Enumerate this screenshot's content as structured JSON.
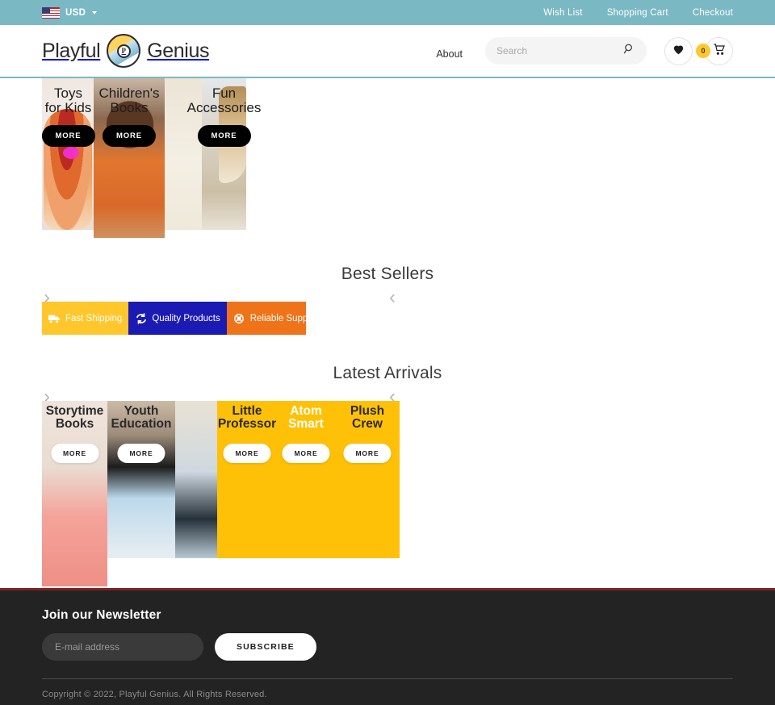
{
  "topbar": {
    "currency": "USD",
    "flag_icon": "us-flag-icon",
    "links": [
      {
        "label": "Wish List"
      },
      {
        "label": "Shopping Cart"
      },
      {
        "label": "Checkout"
      }
    ]
  },
  "header": {
    "logo_left": "Playful",
    "logo_mark_letter": "P",
    "logo_right": "Genius",
    "nav_about": "About",
    "search_placeholder": "Search",
    "search_value": "",
    "search_icon": "search-icon",
    "wishlist_icon": "heart-icon",
    "cart_icon": "cart-icon",
    "cart_count": "0"
  },
  "categories": [
    {
      "title": "Toys\nfor Kids",
      "more": "MORE"
    },
    {
      "title": "Children's\nBooks",
      "more": "MORE"
    },
    {
      "title": "",
      "more": ""
    },
    {
      "title": "Fun\nAccessories",
      "more": "MORE"
    }
  ],
  "best_sellers": {
    "title": "Best Sellers",
    "prev_arrow": "›",
    "next_arrow": "‹"
  },
  "services": [
    {
      "label": "Fast Shipping",
      "icon": "truck-icon",
      "color": "#ffc72c"
    },
    {
      "label": "Quality Products",
      "icon": "refresh-icon",
      "color": "#1b1bb3"
    },
    {
      "label": "Reliable Support",
      "icon": "lifebuoy-icon",
      "color": "#ef7318"
    }
  ],
  "latest_arrivals": {
    "title": "Latest Arrivals",
    "prev_arrow": "›",
    "next_arrow": "‹",
    "cards": [
      {
        "title": "Storytime\nBooks",
        "more": "MORE"
      },
      {
        "title": "Youth\nEducation",
        "more": "MORE"
      },
      {
        "title": "",
        "more": ""
      },
      {
        "title": "Little\nProfessor",
        "more": "MORE"
      },
      {
        "title": "Atom\nSmart",
        "more": "MORE"
      },
      {
        "title": "Plush\nCrew",
        "more": "MORE"
      }
    ]
  },
  "footer": {
    "newsletter_title": "Join our Newsletter",
    "email_placeholder": "E-mail address",
    "email_value": "",
    "subscribe_label": "SUBSCRIBE",
    "copyright": "Copyright © 2022, Playful Genius. All Rights Reserved."
  }
}
